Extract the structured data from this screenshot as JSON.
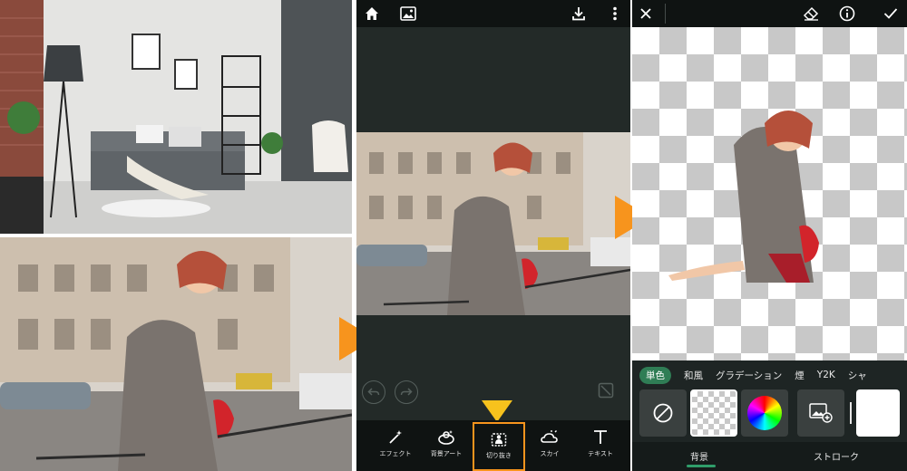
{
  "colors": {
    "accent_orange": "#f7941d",
    "pointer_yellow": "#f7c21d",
    "active_green": "#2f7d55"
  },
  "editor": {
    "top_icons": [
      "home-icon",
      "gallery-icon",
      "download-icon",
      "more-icon"
    ],
    "tools": [
      {
        "icon": "magic-wand-icon",
        "label": "エフェクト"
      },
      {
        "icon": "background-art-icon",
        "label": "背景アート"
      },
      {
        "icon": "cutout-icon",
        "label": "切り抜き",
        "active": true
      },
      {
        "icon": "sky-icon",
        "label": "スカイ"
      },
      {
        "icon": "text-icon",
        "label": "テキスト"
      }
    ]
  },
  "background_panel": {
    "top_icons": [
      "close-icon",
      "eraser-icon",
      "info-icon",
      "check-icon"
    ],
    "tabs": [
      "単色",
      "和風",
      "グラデーション",
      "煙",
      "Y2K",
      "シャ"
    ],
    "active_tab": "単色",
    "bottom_tabs": [
      "背景",
      "ストローク"
    ],
    "active_bottom_tab": "背景"
  }
}
